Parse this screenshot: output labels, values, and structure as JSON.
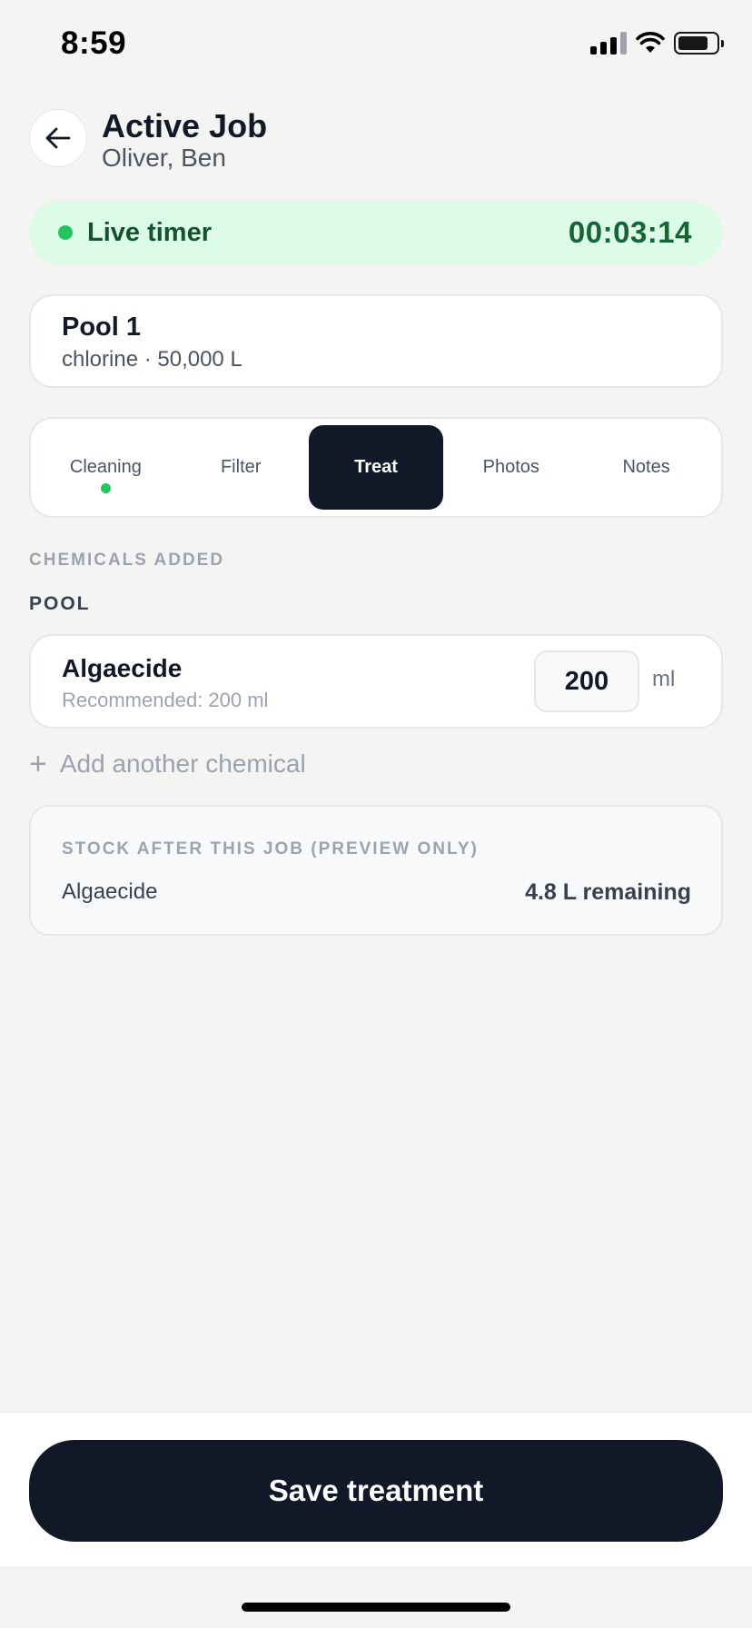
{
  "status_bar": {
    "time": "8:59"
  },
  "header": {
    "title": "Active Job",
    "subtitle": "Oliver, Ben"
  },
  "timer": {
    "label": "Live timer",
    "value": "00:03:14"
  },
  "pool": {
    "name": "Pool 1",
    "meta": "chlorine · 50,000 L"
  },
  "tabs": [
    {
      "label": "Cleaning",
      "has_dot": true,
      "active": false
    },
    {
      "label": "Filter",
      "active": false
    },
    {
      "label": "Treat",
      "active": true
    },
    {
      "label": "Photos",
      "active": false
    },
    {
      "label": "Notes",
      "active": false
    }
  ],
  "chemicals": {
    "section_label": "CHEMICALS ADDED",
    "group_label": "POOL",
    "items": [
      {
        "name": "Algaecide",
        "recommended": "Recommended: 200 ml",
        "value": "200",
        "unit": "ml"
      }
    ],
    "add_label": "Add another chemical"
  },
  "stock": {
    "title": "STOCK AFTER THIS JOB (PREVIEW ONLY)",
    "items": [
      {
        "name": "Algaecide",
        "remaining": "4.8 L remaining"
      }
    ]
  },
  "footer": {
    "save_label": "Save treatment"
  },
  "colors": {
    "accent": "#111827",
    "live_green": "#22c55e",
    "timer_bg": "#dcfce7"
  }
}
